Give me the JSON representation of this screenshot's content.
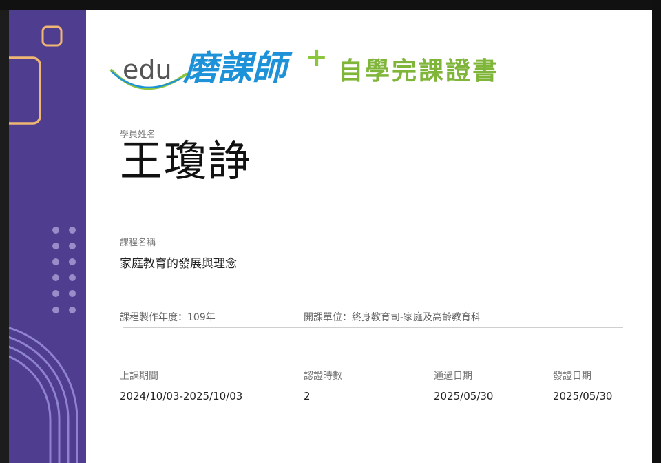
{
  "logo": {
    "edu_text": "edu",
    "brand_text": "磨課師",
    "plus": "+"
  },
  "certificate_title": "自學完課證書",
  "student": {
    "label": "學員姓名",
    "name": "王瓊諍"
  },
  "course": {
    "label": "課程名稱",
    "name": "家庭教育的發展與理念"
  },
  "meta": {
    "year_label": "課程製作年度",
    "year_value": "109年",
    "unit_label": "開課單位",
    "unit_value": "終身教育司-家庭及高齡教育科"
  },
  "details": [
    {
      "label": "上課期間",
      "value": "2024/10/03-2025/10/03"
    },
    {
      "label": "認證時數",
      "value": "2"
    },
    {
      "label": "通過日期",
      "value": "2025/05/30"
    },
    {
      "label": "發證日期",
      "value": "2025/05/30"
    }
  ],
  "colors": {
    "sidebar": "#4f3d8f",
    "accent_orange": "#f0b774",
    "title_green": "#7fb539",
    "brand_blue": "#1e92d8"
  },
  "icons": [
    "rounded-square-decor",
    "dot-grid-decor",
    "arc-lines-decor"
  ]
}
